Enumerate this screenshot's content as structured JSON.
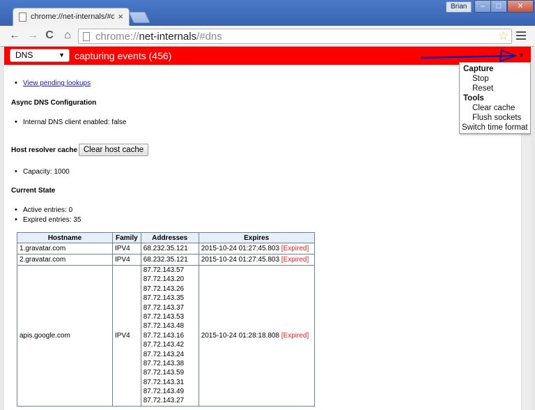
{
  "window": {
    "tab_title": "chrome://net-internals/#dns",
    "tab_close": "×",
    "user": "Brian",
    "min": "–",
    "max": "□",
    "close": "✕"
  },
  "toolbar": {
    "url_scheme": "chrome://",
    "url_host": "net-internals",
    "url_path": "/#dns",
    "back": "←",
    "forward": "→",
    "reload": "C",
    "home": "⌂",
    "star": "☆"
  },
  "status": {
    "tab_select": "DNS",
    "capture_text": "capturing events (456)",
    "accent": "#ff0000"
  },
  "menu": {
    "capture_header": "Capture",
    "stop": "Stop",
    "reset": "Reset",
    "tools_header": "Tools",
    "clear_cache": "Clear cache",
    "flush_sockets": "Flush sockets",
    "switch_time": "Switch time format"
  },
  "content": {
    "pending_link": "View pending lookups",
    "async_heading": "Async DNS Configuration",
    "internal_client": "Internal DNS client enabled: false",
    "cache_label": "Host resolver cache",
    "clear_button": "Clear host cache",
    "capacity": "Capacity: 1000",
    "state_heading": "Current State",
    "active": "Active entries: 0",
    "expired": "Expired entries: 35"
  },
  "table": {
    "headers": [
      "Hostname",
      "Family",
      "Addresses",
      "Expires"
    ],
    "expired_tag": "[Expired]",
    "rows": [
      {
        "hostname": "1.gravatar.com",
        "family": "IPV4",
        "addresses": [
          "68.232.35.121"
        ],
        "expires": "2015-10-24 01:27:45.803"
      },
      {
        "hostname": "2.gravatar.com",
        "family": "IPV4",
        "addresses": [
          "68.232.35.121"
        ],
        "expires": "2015-10-24 01:27:45.803"
      },
      {
        "hostname": "apis.google.com",
        "family": "IPV4",
        "addresses": [
          "87.72.143.57",
          "87.72.143.20",
          "87.72.143.26",
          "87.72.143.35",
          "87.72.143.37",
          "87.72.143.53",
          "87.72.143.48",
          "87.72.143.16",
          "87.72.143.42",
          "87.72.143.24",
          "87.72.143.38",
          "87.72.143.59",
          "87.72.143.31",
          "87.72.143.49",
          "87.72.143.27"
        ],
        "expires": "2015-10-24 01:28:18.808"
      }
    ]
  }
}
